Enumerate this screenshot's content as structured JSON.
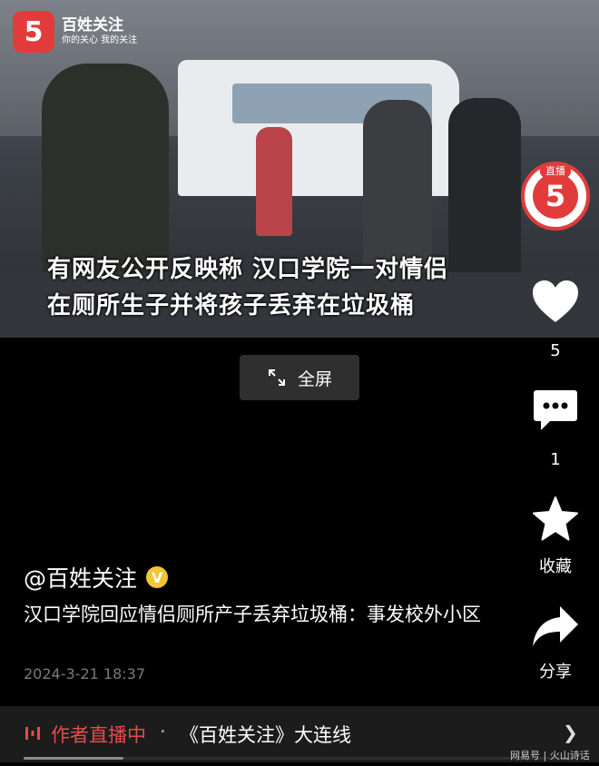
{
  "video": {
    "logo": {
      "name": "百姓关注",
      "slogan": "你的关心 我的关注",
      "mark": "5"
    },
    "caption_line1": "有网友公开反映称 汉口学院一对情侣",
    "caption_line2": "在厕所生子并将孩子丢弃在垃圾桶",
    "live_badge_label": "直播",
    "live_badge_mark": "5",
    "fullscreen_label": "全屏"
  },
  "rail": {
    "like_count": "5",
    "comment_count": "1",
    "favorite_label": "收藏",
    "share_label": "分享"
  },
  "post": {
    "author": "@百姓关注",
    "verified_mark": "V",
    "description": "汉口学院回应情侣厕所产子丢弃垃圾桶：事发校外小区",
    "date": "2024-3-21 18:37"
  },
  "live_bar": {
    "status": "作者直播中",
    "separator": "·",
    "title": "《百姓关注》大连线",
    "accent": "#e84a4a"
  },
  "watermark": "网易号 | 火山诗话",
  "playback_progress_fraction": 0.18
}
